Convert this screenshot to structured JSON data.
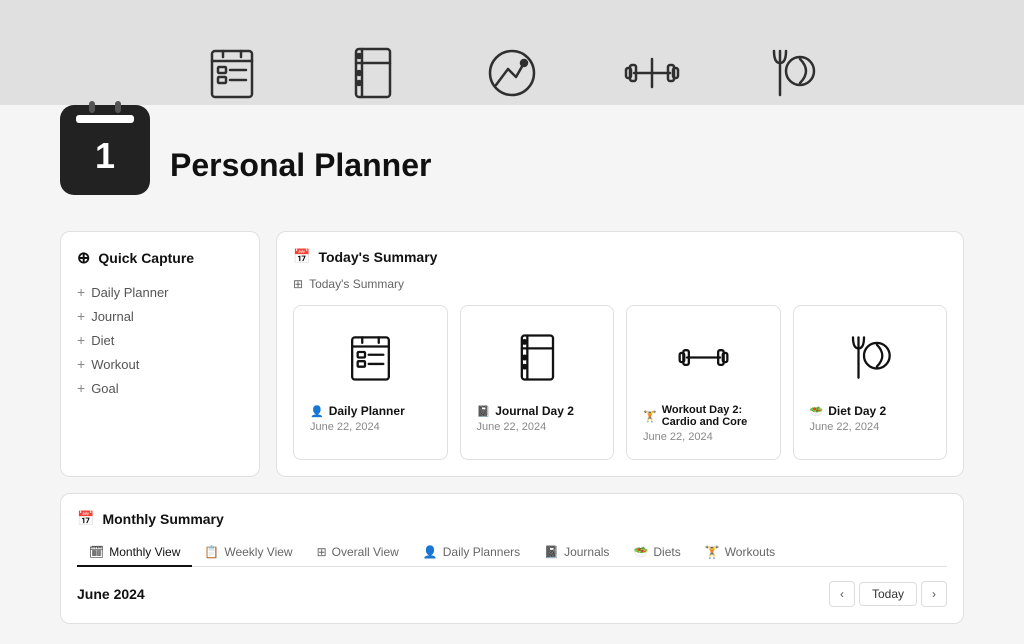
{
  "topBanner": {
    "icons": [
      {
        "name": "daily-planner-icon",
        "label": "Daily Planner"
      },
      {
        "name": "journal-icon",
        "label": "Journal"
      },
      {
        "name": "goal-icon",
        "label": "Goal"
      },
      {
        "name": "workout-icon",
        "label": "Workout"
      },
      {
        "name": "diet-icon",
        "label": "Diet"
      }
    ]
  },
  "page": {
    "title": "Personal Planner",
    "calendarNumber": "1"
  },
  "quickCapture": {
    "title": "Quick Capture",
    "items": [
      {
        "label": "Daily Planner"
      },
      {
        "label": "Journal"
      },
      {
        "label": "Diet"
      },
      {
        "label": "Workout"
      },
      {
        "label": "Goal"
      }
    ]
  },
  "todaysSummary": {
    "title": "Today's Summary",
    "subtitle": "Today's Summary",
    "cards": [
      {
        "title": "Daily Planner",
        "date": "June 22, 2024",
        "icon": "daily-planner-card-icon"
      },
      {
        "title": "Journal Day 2",
        "date": "June 22, 2024",
        "icon": "journal-card-icon"
      },
      {
        "title": "Workout Day 2: Cardio and Core",
        "date": "June 22, 2024",
        "icon": "workout-card-icon"
      },
      {
        "title": "Diet Day 2",
        "date": "June 22, 2024",
        "icon": "diet-card-icon"
      }
    ]
  },
  "monthlySummary": {
    "title": "Monthly Summary",
    "tabs": [
      {
        "label": "Monthly View",
        "active": true
      },
      {
        "label": "Weekly View",
        "active": false
      },
      {
        "label": "Overall View",
        "active": false
      },
      {
        "label": "Daily Planners",
        "active": false
      },
      {
        "label": "Journals",
        "active": false
      },
      {
        "label": "Diets",
        "active": false
      },
      {
        "label": "Workouts",
        "active": false
      }
    ],
    "currentMonth": "June 2024",
    "todayButton": "Today"
  }
}
